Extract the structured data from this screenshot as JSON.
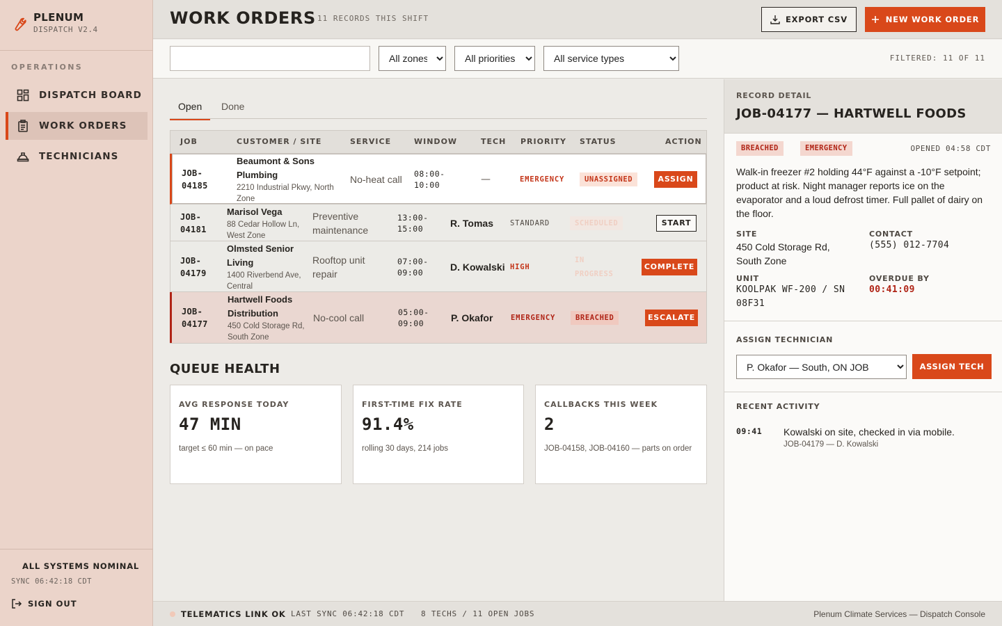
{
  "brand": {
    "name": "PLENUM",
    "version": "DISPATCH V2.4"
  },
  "sidebar": {
    "section": "OPERATIONS",
    "items": [
      {
        "label": "DISPATCH BOARD",
        "icon": "grid-icon"
      },
      {
        "label": "WORK ORDERS",
        "icon": "clipboard-icon",
        "active": true
      },
      {
        "label": "TECHNICIANS",
        "icon": "hardhat-icon"
      }
    ],
    "system_status": "ALL SYSTEMS NOMINAL",
    "sync": "SYNC 06:42:18 CDT",
    "signout": "SIGN OUT"
  },
  "header": {
    "title": "WORK ORDERS",
    "count": "11 RECORDS THIS SHIFT",
    "export_label": "EXPORT CSV",
    "new_label": "NEW WORK ORDER"
  },
  "filters": {
    "search_value": "",
    "zone": "All zones",
    "priority": "All priorities",
    "service": "All service types",
    "filtered": "FILTERED: 11 OF 11"
  },
  "tabs": [
    {
      "label": "Open",
      "active": true
    },
    {
      "label": "Done"
    }
  ],
  "table": {
    "headers": [
      "JOB",
      "CUSTOMER / SITE",
      "SERVICE",
      "WINDOW",
      "TECH",
      "PRIORITY",
      "STATUS",
      "ACTION"
    ],
    "rows": [
      {
        "job": "JOB-04185",
        "customer": "Beaumont & Sons Plumbing",
        "site": "2210 Industrial Pkwy, North Zone",
        "service": "No-heat call",
        "window": "08:00-10:00",
        "tech": "—",
        "priority": "EMERGENCY",
        "status": "UNASSIGNED",
        "action": "ASSIGN"
      },
      {
        "job": "JOB-04181",
        "customer": "Marisol Vega",
        "site": "88 Cedar Hollow Ln, West Zone",
        "service": "Preventive maintenance",
        "window": "13:00-15:00",
        "tech": "R. Tomas",
        "priority": "STANDARD",
        "status": "SCHEDULED",
        "action": "START"
      },
      {
        "job": "JOB-04179",
        "customer": "Olmsted Senior Living",
        "site": "1400 Riverbend Ave, Central",
        "service": "Rooftop unit repair",
        "window": "07:00-09:00",
        "tech": "D. Kowalski",
        "priority": "HIGH",
        "status": "IN PROGRESS",
        "action": "COMPLETE"
      },
      {
        "job": "JOB-04177",
        "customer": "Hartwell Foods Distribution",
        "site": "450 Cold Storage Rd, South Zone",
        "service": "No-cool call",
        "window": "05:00-09:00",
        "tech": "P. Okafor",
        "priority": "EMERGENCY",
        "status": "BREACHED",
        "action": "ESCALATE"
      }
    ]
  },
  "queue_health": {
    "title": "QUEUE HEALTH",
    "cards": [
      {
        "label": "AVG RESPONSE TODAY",
        "value": "47 MIN",
        "note": "target ≤ 60 min — on pace"
      },
      {
        "label": "FIRST-TIME FIX RATE",
        "value": "91.4%",
        "note": "rolling 30 days, 214 jobs"
      },
      {
        "label": "CALLBACKS THIS WEEK",
        "value": "2",
        "note": "JOB-04158, JOB-04160 — parts on order"
      }
    ]
  },
  "detail": {
    "label": "RECORD DETAIL",
    "title": "JOB-04177 — HARTWELL FOODS",
    "tags": [
      "BREACHED",
      "EMERGENCY"
    ],
    "opened": "OPENED 04:58 CDT",
    "description": "Walk-in freezer #2 holding 44°F against a -10°F setpoint; product at risk. Night manager reports ice on the evaporator and a loud defrost timer. Full pallet of dairy on the floor.",
    "site_label": "SITE",
    "site": "450 Cold Storage Rd, South Zone",
    "contact_label": "CONTACT",
    "contact": "(555) 012-7704",
    "unit_label": "UNIT",
    "unit": "KOOLPAK WF-200 / SN 08F31",
    "overdue_label": "OVERDUE BY",
    "overdue": "00:41:09",
    "assign_label": "ASSIGN TECHNICIAN",
    "assign_value": "P. Okafor — South, ON JOB",
    "assign_button": "ASSIGN TECH",
    "activity_label": "RECENT ACTIVITY",
    "activity": [
      {
        "time": "09:41",
        "text": "Kowalski on site, checked in via mobile.",
        "sub": "JOB-04179 — D. Kowalski"
      }
    ]
  },
  "statusbar": {
    "link": "TELEMATICS LINK OK",
    "last_sync": "LAST SYNC 06:42:18 CDT",
    "counts": "8 TECHS / 11 OPEN JOBS",
    "app": "Plenum Climate Services — Dispatch Console"
  },
  "colors": {
    "accent": "#d9481a",
    "breach": "#b02416",
    "sidebar": "#ebd4ca"
  }
}
